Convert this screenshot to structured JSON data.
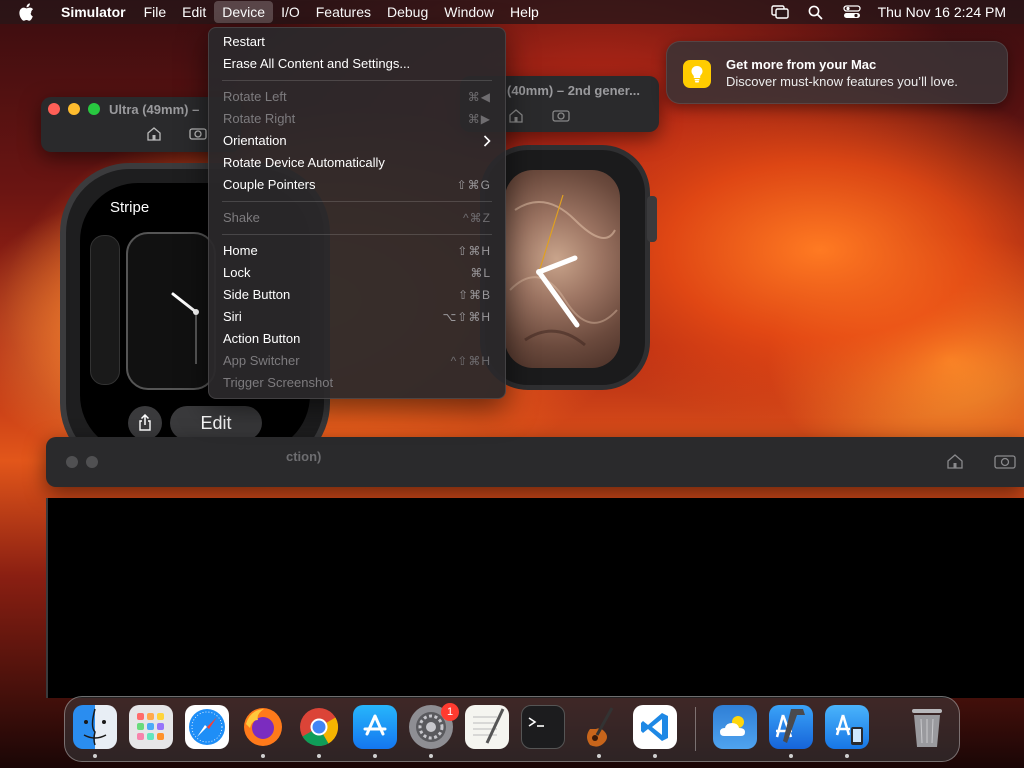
{
  "menubar": {
    "app_name": "Simulator",
    "items": [
      "File",
      "Edit",
      "Device",
      "I/O",
      "Features",
      "Debug",
      "Window",
      "Help"
    ],
    "active_item": "Device",
    "clock": "Thu Nov 16  2:24 PM",
    "status_icons": [
      "screen-mirroring-icon",
      "search-icon",
      "control-center-icon"
    ]
  },
  "device_menu": {
    "items": [
      {
        "label": "Restart",
        "shortcut": "",
        "enabled": true
      },
      {
        "label": "Erase All Content and Settings...",
        "shortcut": "",
        "enabled": true
      },
      {
        "separator": true
      },
      {
        "label": "Rotate Left",
        "shortcut": "⌘◀",
        "enabled": false
      },
      {
        "label": "Rotate Right",
        "shortcut": "⌘▶",
        "enabled": false
      },
      {
        "label": "Orientation",
        "shortcut": "",
        "submenu": true,
        "enabled": true
      },
      {
        "label": "Rotate Device Automatically",
        "shortcut": "",
        "enabled": true
      },
      {
        "label": "Couple Pointers",
        "shortcut": "⇧⌘G",
        "enabled": true
      },
      {
        "separator": true
      },
      {
        "label": "Shake",
        "shortcut": "^⌘Z",
        "enabled": false
      },
      {
        "separator": true
      },
      {
        "label": "Home",
        "shortcut": "⇧⌘H",
        "enabled": true
      },
      {
        "label": "Lock",
        "shortcut": "⌘L",
        "enabled": true
      },
      {
        "label": "Side Button",
        "shortcut": "⇧⌘B",
        "enabled": true
      },
      {
        "label": "Siri",
        "shortcut": "⌥⇧⌘H",
        "enabled": true
      },
      {
        "label": "Action Button",
        "shortcut": "",
        "enabled": true
      },
      {
        "label": "App Switcher",
        "shortcut": "^⇧⌘H",
        "enabled": false
      },
      {
        "label": "Trigger Screenshot",
        "shortcut": "",
        "enabled": false
      }
    ]
  },
  "notification": {
    "title": "Get more from your Mac",
    "body": "Discover must-know features you’ll love.",
    "icon": "lightbulb-icon"
  },
  "windows": {
    "ultra_title": "Ultra (49mm) –",
    "s9_title": "(40mm) – 2nd gener...",
    "third_title": "ction)"
  },
  "watch_ultra": {
    "face_title": "Stripe",
    "edit_label": "Edit",
    "stripe_colors": [
      "#f25a8e",
      "#f6c33a",
      "#2ec7b4",
      "#e8e8e8",
      "#f25a8e",
      "#f6c33a",
      "#2ec7b4",
      "#f9a12b"
    ]
  },
  "dock": {
    "apps": [
      "Finder",
      "Launchpad",
      "Safari",
      "Firefox",
      "Chrome",
      "App Store",
      "System Settings",
      "TextEdit",
      "Terminal",
      "GarageBand",
      "Visual Studio Code",
      "Weather",
      "Xcode",
      "Simulator",
      "Trash"
    ],
    "badge_count": "1"
  }
}
